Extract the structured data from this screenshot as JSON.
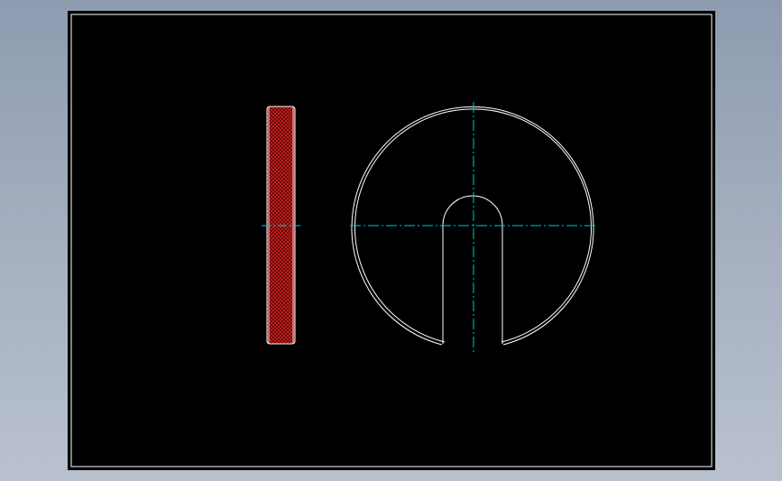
{
  "drawing": {
    "background_color": "#000000",
    "outline_color": "#ffffff",
    "centerline_color": "#00c8d0",
    "hatch_color": "#c41818",
    "views": [
      {
        "name": "side-section-view",
        "hatched": true
      },
      {
        "name": "front-view",
        "shape": "slotted disc",
        "slot": "u-shaped"
      }
    ]
  }
}
